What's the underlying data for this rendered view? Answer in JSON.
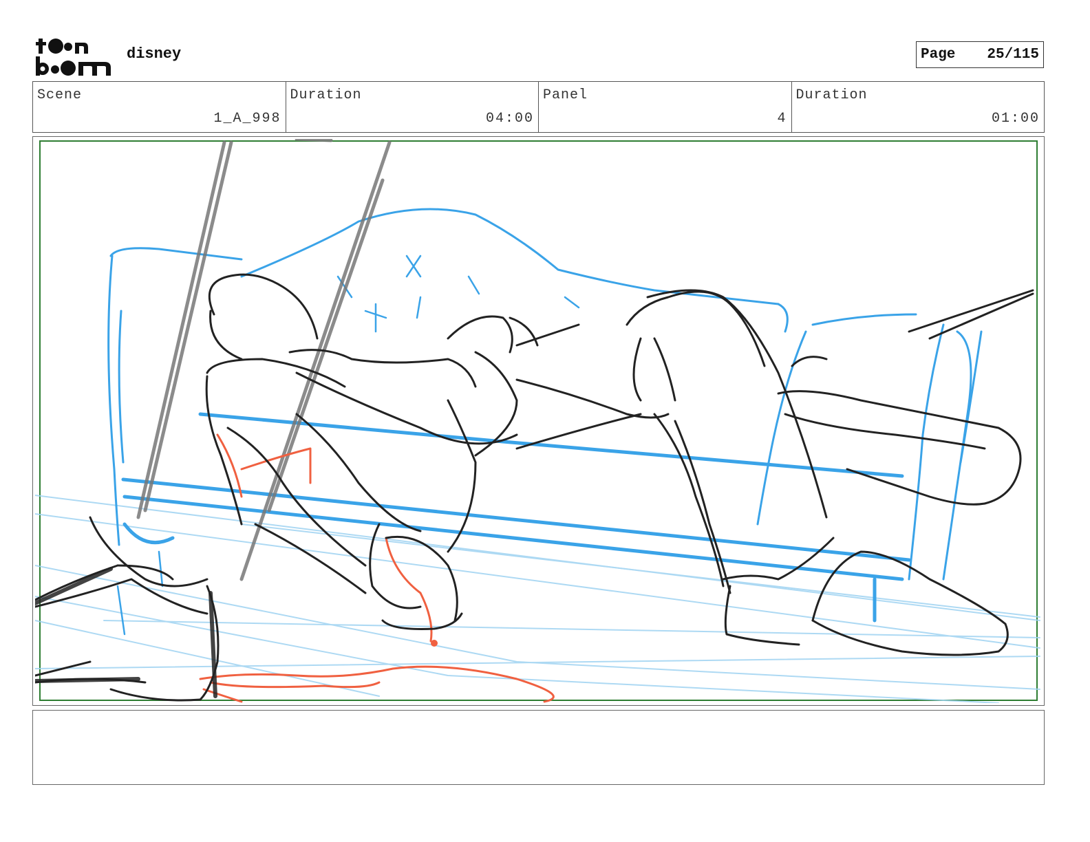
{
  "header": {
    "logo_text": "toon boom",
    "project": "disney",
    "page_label": "Page",
    "page_value": "25/115"
  },
  "info": [
    {
      "label": "Scene",
      "value": "1_A_998"
    },
    {
      "label": "Duration",
      "value": "04:00"
    },
    {
      "label": "Panel",
      "value": "4"
    },
    {
      "label": "Duration",
      "value": "01:00"
    }
  ],
  "panel": {
    "frame_color": "#2e7d32",
    "colors": {
      "rough": "#222222",
      "layout": "#3aa3e8",
      "accent": "#f06040",
      "construction": "#777777"
    }
  },
  "notes": {
    "text": ""
  }
}
